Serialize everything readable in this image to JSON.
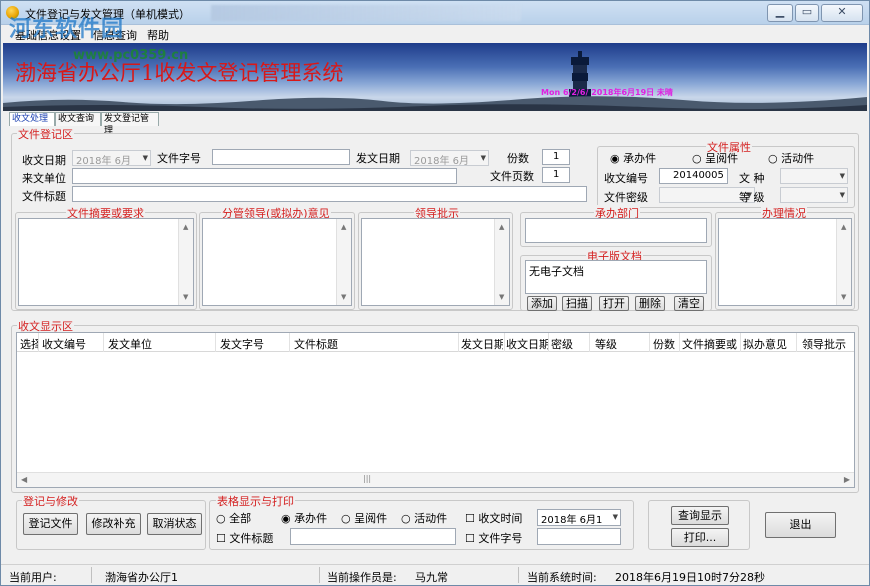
{
  "window": {
    "title": "文件登记与发文管理（单机模式）"
  },
  "watermark": {
    "text": "河东软件园",
    "url": "www.pc0359.cn"
  },
  "menu": [
    "基础信息设置",
    "信息查询",
    "帮助"
  ],
  "banner": {
    "title": "渤海省办公厅1收发文登记管理系统",
    "subtitle": "Mon 6/2/6/ 2018年6月19日 未晴"
  },
  "tabs": [
    "收文处理",
    "收文查询",
    "发文登记管理"
  ],
  "register": {
    "legend": "文件登记区",
    "recv_date_label": "收文日期",
    "recv_date": "2018年 6月",
    "doc_no_label": "文件字号",
    "doc_no": "",
    "send_date_label": "发文日期",
    "send_date": "2018年 6月",
    "copies_label": "份数",
    "copies": "1",
    "pages_label": "文件页数",
    "pages": "1",
    "from_unit_label": "来文单位",
    "from_unit": "",
    "doc_title_label": "文件标题",
    "doc_title": ""
  },
  "attributes": {
    "legend": "文件属性",
    "options": [
      "承办件",
      "呈阅件",
      "活动件"
    ],
    "selected": "承办件",
    "recv_no_label": "收文编号",
    "recv_no": "20140005",
    "kind_label": "文    种",
    "kind": "",
    "secret_label": "文件密级",
    "secret": "",
    "level_label": "等    级",
    "level": ""
  },
  "panels": {
    "summary": "文件摘要或要求",
    "leader_opinion": "分管领导(或拟办)意见",
    "leader_instruct": "领导批示",
    "dept": "承办部门",
    "handling": "办理情况"
  },
  "edoc": {
    "legend": "电子版文档",
    "content": "无电子文档",
    "buttons": [
      "添加",
      "扫描",
      "打开",
      "删除",
      "清空"
    ]
  },
  "display": {
    "legend": "收文显示区",
    "columns": [
      "选择",
      "收文编号",
      "发文单位",
      "发文字号",
      "文件标题",
      "发文日期",
      "收文日期",
      "密级",
      "等级",
      "份数",
      "文件摘要或",
      "拟办意见",
      "领导批示"
    ]
  },
  "edit_group": {
    "legend": "登记与修改",
    "buttons": [
      "登记文件",
      "修改补充",
      "取消状态"
    ]
  },
  "print_group": {
    "legend": "表格显示与打印",
    "radios": [
      "全部",
      "承办件",
      "呈阅件",
      "活动件"
    ],
    "selected": "承办件",
    "recv_time_label": "收文时间",
    "recv_time": "2018年 6月1",
    "doc_title_label": "文件标题",
    "doc_no_label": "文件字号",
    "query_button": "查询显示",
    "print_button": "打印...",
    "exit_button": "退出"
  },
  "status": {
    "user_label": "当前用户:",
    "user": "渤海省办公厅1",
    "operator_label": "当前操作员是:",
    "operator": "马九常",
    "time_label": "当前系统时间:",
    "time": "2018年6月19日10时7分28秒"
  },
  "colors": {
    "legend": "#d42020",
    "accent": "#1a3fb0",
    "banner_title": "#d81818"
  }
}
